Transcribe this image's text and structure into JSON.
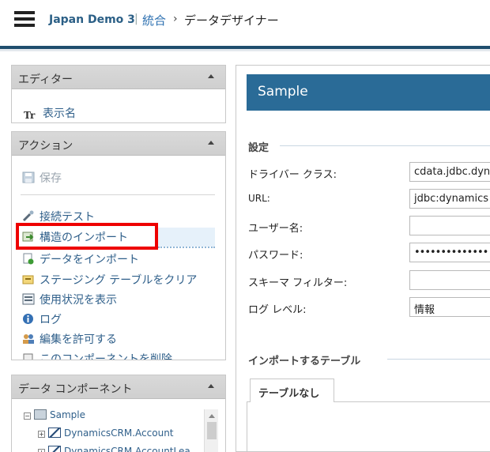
{
  "header": {
    "app_name": "Japan Demo 3",
    "separator": "|",
    "breadcrumb_link": "統合",
    "breadcrumb_arrow": "›",
    "current_page": "データデザイナー"
  },
  "editor_panel": {
    "title": "エディター",
    "items": [
      {
        "icon": "text-format-icon",
        "label": "表示名"
      }
    ]
  },
  "actions_panel": {
    "title": "アクション",
    "items": [
      {
        "icon": "save-icon",
        "label": "保存",
        "disabled": true
      },
      {
        "icon": "connection-test-icon",
        "label": "接続テスト"
      },
      {
        "icon": "import-structure-icon",
        "label": "構造のインポート"
      },
      {
        "icon": "import-data-icon",
        "label": "データをインポート"
      },
      {
        "icon": "clear-staging-icon",
        "label": "ステージング テーブルをクリア"
      },
      {
        "icon": "usage-icon",
        "label": "使用状況を表示"
      },
      {
        "icon": "log-icon",
        "label": "ログ"
      },
      {
        "icon": "users-icon",
        "label": "編集を許可する"
      },
      {
        "icon": "delete-icon",
        "label": "このコンポーネントを削除"
      }
    ]
  },
  "data_components_panel": {
    "title": "データ コンポーネント",
    "tree": [
      {
        "label": "Sample",
        "level": 0,
        "icon": "database-icon"
      },
      {
        "label": "DynamicsCRM.Account",
        "level": 1,
        "icon": "table-edit-icon"
      },
      {
        "label": "DynamicsCRM.AccountLea",
        "level": 1,
        "icon": "table-edit-icon"
      }
    ]
  },
  "main": {
    "title": "Sample",
    "settings_section": "設定",
    "fields": [
      {
        "label": "ドライバー クラス:",
        "value": "cdata.jdbc.dyn"
      },
      {
        "label": "URL:",
        "value": "jdbc:dynamics"
      },
      {
        "label": "ユーザー名:",
        "value": ""
      },
      {
        "label": "パスワード:",
        "value": "••••••••••••••"
      },
      {
        "label": "スキーマ フィルター:",
        "value": ""
      },
      {
        "label": "ログ レベル:",
        "value": "情報"
      }
    ],
    "import_section": "インポートするテーブル",
    "tab_label": "テーブルなし"
  },
  "colors": {
    "nav_rule": "#1f4e6e",
    "banner": "#2a6b97",
    "link": "#2f5f8a",
    "highlight": "#e00000"
  }
}
